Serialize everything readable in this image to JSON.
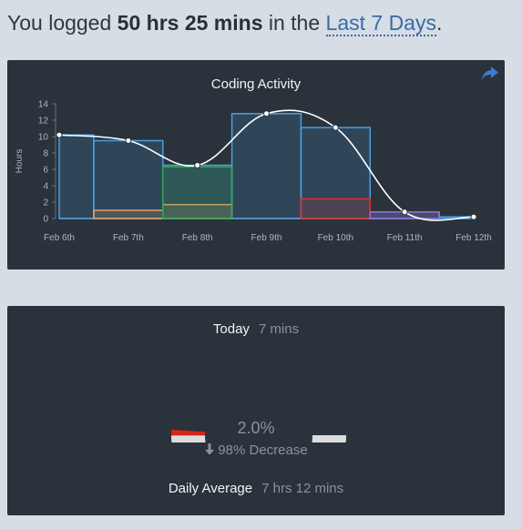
{
  "header": {
    "prefix": "You logged ",
    "total": "50 hrs 25 mins",
    "middle": " in the ",
    "range_link": "Last 7 Days",
    "suffix": "."
  },
  "chart_data": {
    "type": "area",
    "title": "Coding Activity",
    "ylabel": "Hours",
    "xlabel": "",
    "ylim": [
      0,
      14
    ],
    "y_ticks": [
      "0",
      "2",
      "4",
      "6",
      "8",
      "10",
      "12",
      "14"
    ],
    "x": [
      "Feb 6th",
      "Feb 7th",
      "Feb 8th",
      "Feb 9th",
      "Feb 10th",
      "Feb 11th",
      "Feb 12th"
    ],
    "series": [
      {
        "values": [
          10.2,
          9.5,
          6.5,
          12.8,
          11.1,
          0.8,
          0.2
        ],
        "color": "#4a9fe0"
      },
      {
        "values": [
          0,
          1.0,
          1.7,
          0,
          0,
          0,
          0
        ],
        "color": "#e3a06a"
      },
      {
        "values": [
          0,
          0,
          6.3,
          0,
          0,
          0,
          0
        ],
        "color": "#2fa84f"
      },
      {
        "values": [
          0,
          0,
          0,
          0,
          2.4,
          0,
          0
        ],
        "color": "#e02e2e"
      },
      {
        "values": [
          0,
          0,
          0,
          0,
          0,
          0.8,
          0
        ],
        "color": "#9b6fd0"
      }
    ],
    "total_line": [
      10.2,
      9.5,
      6.5,
      12.8,
      11.1,
      0.8,
      0.2
    ],
    "grid": false,
    "legend": "none"
  },
  "today": {
    "label": "Today",
    "value": "7 mins",
    "percent_text": "2.0%",
    "percent_value": 2.0,
    "change_text": "98% Decrease",
    "average_label": "Daily Average",
    "average_value": "7 hrs 12 mins"
  },
  "colors": {
    "background": "#d6dde4",
    "panel": "#2a323c",
    "link": "#3a6aa8",
    "gauge_track": "#dcdcdc",
    "gauge_fill": "#d9261c"
  },
  "icons": {
    "share": "share-icon",
    "down_arrow": "arrow-down-icon"
  }
}
